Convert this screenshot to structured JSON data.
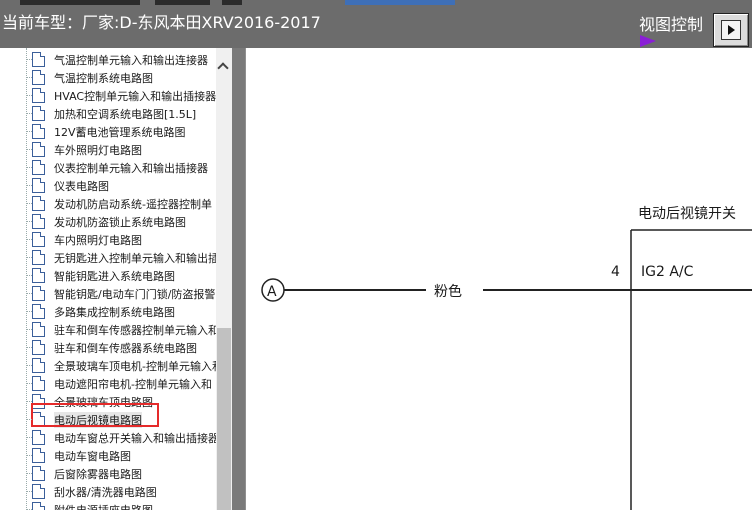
{
  "header": {
    "title": "当前车型：厂家:D-东风本田XRV2016-2017",
    "view_control": "视图控制"
  },
  "tree": {
    "items": [
      {
        "label": "气温控制单元输入和输出连接器"
      },
      {
        "label": "气温控制系统电路图"
      },
      {
        "label": "HVAC控制单元输入和输出插接器"
      },
      {
        "label": "加热和空调系统电路图[1.5L]"
      },
      {
        "label": "12V蓄电池管理系统电路图"
      },
      {
        "label": "车外照明灯电路图"
      },
      {
        "label": "仪表控制单元输入和输出插接器"
      },
      {
        "label": "仪表电路图"
      },
      {
        "label": "发动机防启动系统-遥控器控制单"
      },
      {
        "label": "发动机防盗锁止系统电路图"
      },
      {
        "label": "车内照明灯电路图"
      },
      {
        "label": "无钥匙进入控制单元输入和输出插"
      },
      {
        "label": "智能钥匙进入系统电路图"
      },
      {
        "label": "智能钥匙/电动车门门锁/防盗报警"
      },
      {
        "label": "多路集成控制系统电路图"
      },
      {
        "label": "驻车和倒车传感器控制单元输入和"
      },
      {
        "label": "驻车和倒车传感器系统电路图"
      },
      {
        "label": "全景玻璃车顶电机-控制单元输入和"
      },
      {
        "label": "电动遮阳帘电机-控制单元输入和"
      },
      {
        "label": "全景玻璃车顶电路图"
      },
      {
        "label": "电动后视镜电路图"
      },
      {
        "label": "电动车窗总开关输入和输出插接器"
      },
      {
        "label": "电动车窗电路图"
      },
      {
        "label": "后窗除雾器电路图"
      },
      {
        "label": "刮水器/清洗器电路图"
      },
      {
        "label": "附件电源插座电路图"
      }
    ],
    "selected_index": 20
  },
  "diagram": {
    "component_title": "电动后视镜开关",
    "connector_label": "A",
    "wire_color": "粉色",
    "pin_number": "4",
    "pin_label": "IG2 A/C"
  },
  "colors": {
    "header_bg": "#6c6c6c",
    "highlight": "#e52a2a",
    "accent_arrow": "#8a1fd6"
  }
}
